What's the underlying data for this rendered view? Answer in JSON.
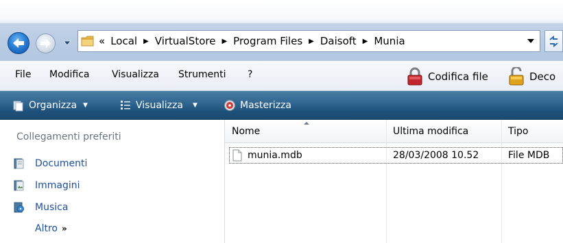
{
  "address": {
    "lead": "«",
    "crumbs": [
      "Local",
      "VirtualStore",
      "Program Files",
      "Daisoft",
      "Munia"
    ]
  },
  "menu": {
    "items": [
      "File",
      "Modifica",
      "Visualizza",
      "Strumenti",
      "?"
    ],
    "encode_label": "Codifica file",
    "decode_label": "Deco"
  },
  "command_bar": {
    "organize": "Organizza",
    "views": "Visualizza",
    "burn": "Masterizza"
  },
  "nav_pane": {
    "heading": "Collegamenti preferiti",
    "links": [
      {
        "label": "Documenti",
        "icon": "documents-icon"
      },
      {
        "label": "Immagini",
        "icon": "pictures-icon"
      },
      {
        "label": "Musica",
        "icon": "music-icon"
      }
    ],
    "more": "Altro",
    "more_glyph": "»"
  },
  "file_list": {
    "columns": [
      "Nome",
      "Ultima modifica",
      "Tipo"
    ],
    "rows": [
      {
        "name": "munia.mdb",
        "modified": "28/03/2008 10.52",
        "type": "File MDB"
      }
    ]
  },
  "colors": {
    "command_bar": "#1d5079",
    "link": "#1e4f9b",
    "address_border": "#7f9db9"
  }
}
